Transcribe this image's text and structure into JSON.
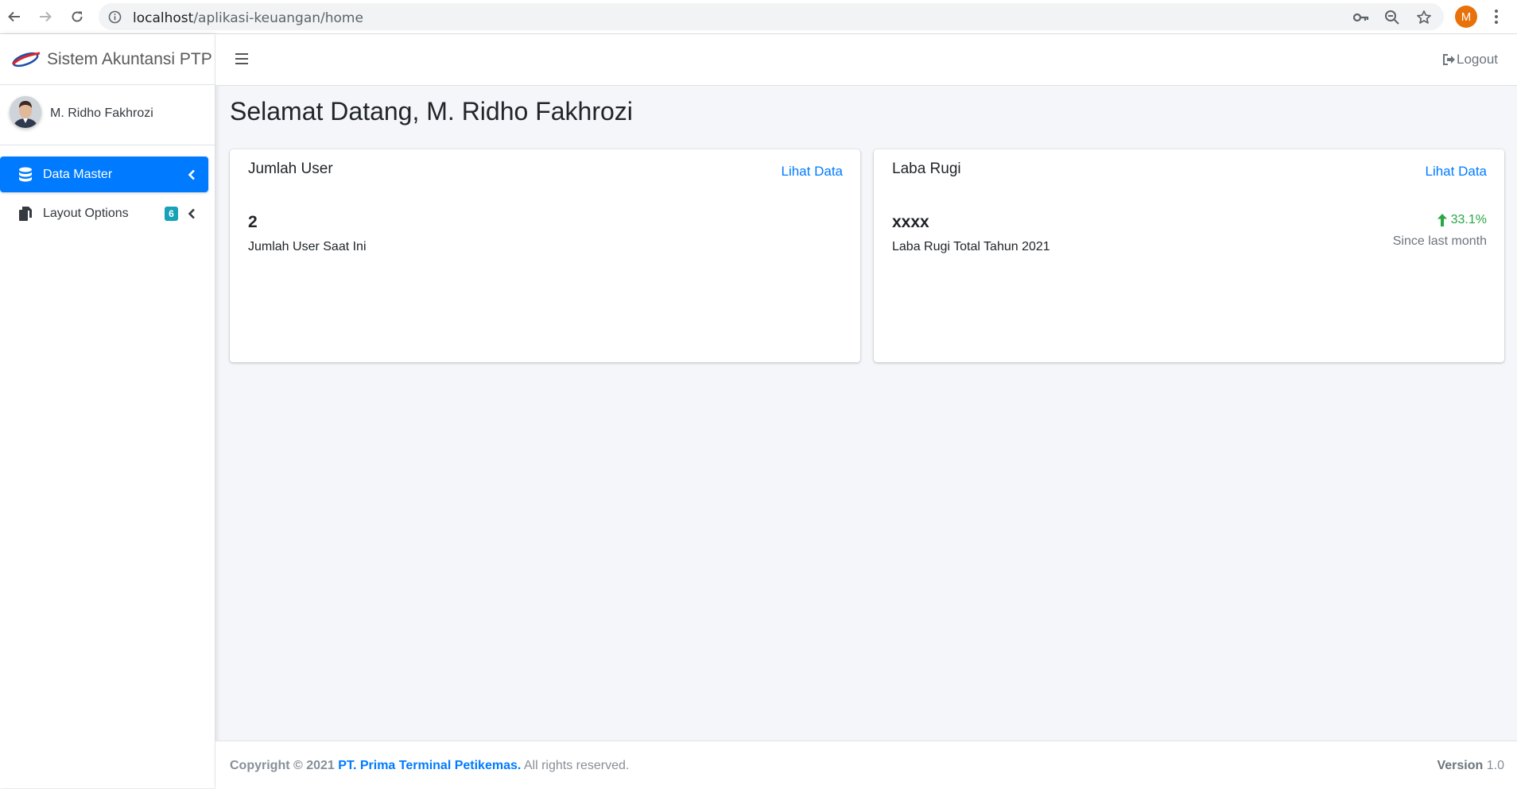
{
  "browser": {
    "url_host": "localhost",
    "url_path": "/aplikasi-keuangan/home",
    "profile_initial": "M"
  },
  "sidebar": {
    "brand": "Sistem Akuntansi PTP",
    "user_name": "M. Ridho Fakhrozi",
    "items": [
      {
        "label": "Data Master",
        "icon": "database-icon",
        "active": true
      },
      {
        "label": "Layout Options",
        "icon": "copy-icon",
        "badge": "6"
      }
    ]
  },
  "navbar": {
    "logout_label": "Logout"
  },
  "main": {
    "welcome": "Selamat Datang, M. Ridho Fakhrozi",
    "cards": [
      {
        "title": "Jumlah User",
        "link": "Lihat Data",
        "value": "2",
        "description": "Jumlah User Saat Ini"
      },
      {
        "title": "Laba Rugi",
        "link": "Lihat Data",
        "value": "xxxx",
        "description": "Laba Rugi Total Tahun 2021",
        "change": "33.1%",
        "change_note": "Since last month"
      }
    ]
  },
  "footer": {
    "copyright_prefix": "Copyright © 2021",
    "company": "PT. Prima Terminal Petikemas.",
    "rights": "All rights reserved.",
    "version_label": "Version",
    "version_value": "1.0"
  },
  "colors": {
    "primary": "#007bff",
    "success": "#28a745",
    "badge": "#17a2b8",
    "profile": "#e8710a"
  }
}
